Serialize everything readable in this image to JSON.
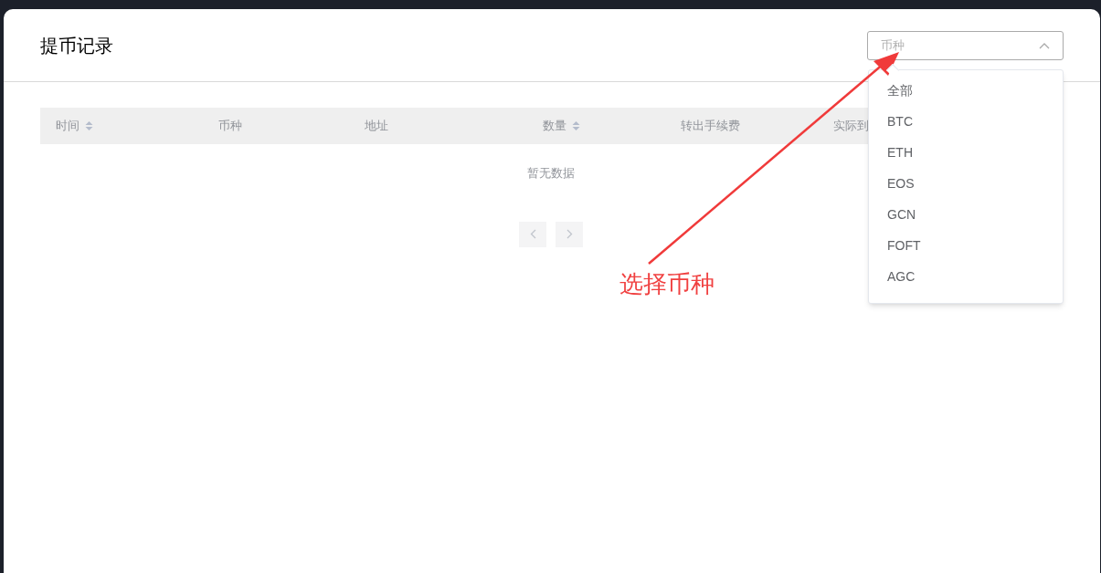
{
  "title": "提币记录",
  "currency_select": {
    "placeholder": "币种",
    "expanded": true,
    "options": [
      {
        "label": "全部"
      },
      {
        "label": "BTC"
      },
      {
        "label": "ETH"
      },
      {
        "label": "EOS"
      },
      {
        "label": "GCN"
      },
      {
        "label": "FOFT"
      },
      {
        "label": "AGC"
      }
    ]
  },
  "table": {
    "columns": [
      {
        "label": "时间",
        "sortable": true
      },
      {
        "label": "币种",
        "sortable": false
      },
      {
        "label": "地址",
        "sortable": false
      },
      {
        "label": "数量",
        "sortable": true
      },
      {
        "label": "转出手续费",
        "sortable": false
      },
      {
        "label": "实际到",
        "sortable": false
      }
    ],
    "empty_text": "暂无数据"
  },
  "pagination": {
    "prev_disabled": true,
    "next_disabled": true
  },
  "annotation": {
    "text": "选择币种"
  }
}
